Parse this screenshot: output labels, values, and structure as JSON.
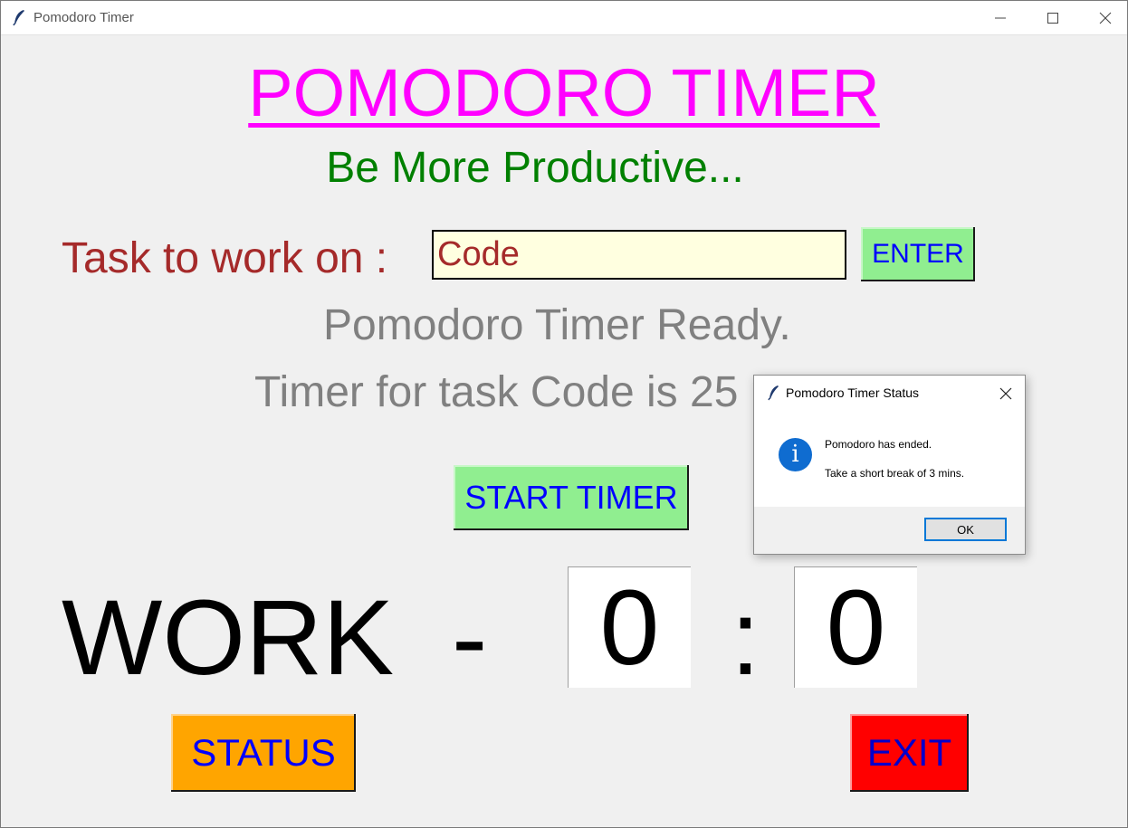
{
  "window": {
    "title": "Pomodoro Timer",
    "controls": {
      "minimize": "minimize-icon",
      "maximize": "maximize-icon",
      "close": "close-icon"
    }
  },
  "app": {
    "title": "POMODORO TIMER",
    "subtitle": "Be More Productive...",
    "task_label": "Task to work on :",
    "task_value": "Code",
    "enter_label": "ENTER",
    "status_ready": "Pomodoro Timer Ready.",
    "status_timer": "Timer for task Code is 25 mins",
    "start_label": "START TIMER",
    "mode_label": "WORK",
    "dash": "-",
    "minutes": "0",
    "colon": ":",
    "seconds": "0",
    "status_button": "STATUS",
    "exit_button": "EXIT"
  },
  "dialog": {
    "title": "Pomodoro Timer Status",
    "icon": "info-icon",
    "message_line1": "Pomodoro has ended.",
    "message_line2": "Take a short break of 3 mins.",
    "ok_label": "OK"
  },
  "colors": {
    "title": "#ff00ff",
    "subtitle": "#008000",
    "task_label": "#a52a2a",
    "status_text": "#808080",
    "green_button": "#90ee90",
    "status_button": "#ffa500",
    "exit_button": "#ff0000",
    "button_text": "#0000ff",
    "input_background": "#ffffe0"
  }
}
